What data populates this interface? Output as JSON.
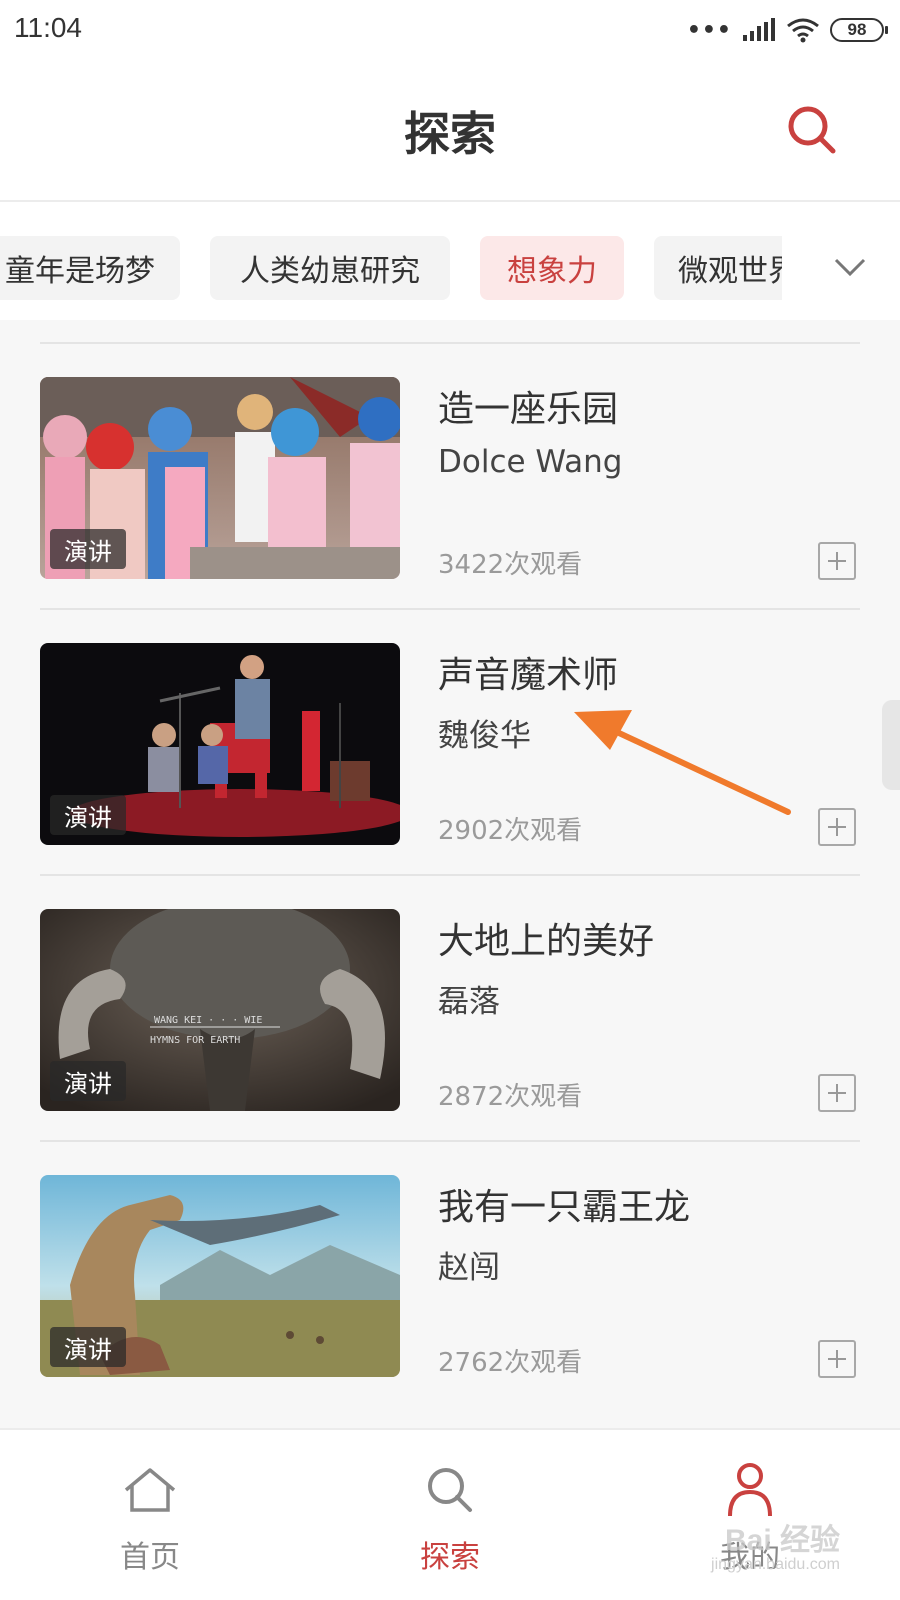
{
  "status_bar": {
    "time": "11:04",
    "dots": "•••",
    "battery": "98"
  },
  "header": {
    "title": "探索"
  },
  "tabs": [
    {
      "label": "童年是场梦"
    },
    {
      "label": "人类幼崽研究"
    },
    {
      "label": "想象力"
    },
    {
      "label": "微观世界"
    }
  ],
  "items": [
    {
      "title": "造一座乐园",
      "author": "Dolce Wang",
      "views": "3422次观看",
      "badge": "演讲"
    },
    {
      "title": "声音魔术师",
      "author": "魏俊华",
      "views": "2902次观看",
      "badge": "演讲"
    },
    {
      "title": "大地上的美好",
      "author": "磊落",
      "views": "2872次观看",
      "badge": "演讲"
    },
    {
      "title": "我有一只霸王龙",
      "author": "赵闯",
      "views": "2762次观看",
      "badge": "演讲"
    }
  ],
  "thumb_text": {
    "item3_line1": "WANG KEI · · · WIE",
    "item3_line2": "HYMNS FOR EARTH"
  },
  "bottom_nav": [
    {
      "label": "首页"
    },
    {
      "label": "探索"
    },
    {
      "label": "我的"
    }
  ],
  "watermark": {
    "main": "Bai 经验",
    "sub": "jingyan.baidu.com"
  },
  "colors": {
    "accent": "#c9413f",
    "tab_active_bg": "#fce8e8",
    "annotation": "#f07a2c"
  },
  "icons": {
    "search": "search-icon",
    "chevron": "chevron-down-icon",
    "add": "plus-square-icon",
    "home": "home-icon",
    "explore": "search-icon",
    "profile": "user-icon",
    "signal": "signal-icon",
    "wifi": "wifi-icon"
  }
}
